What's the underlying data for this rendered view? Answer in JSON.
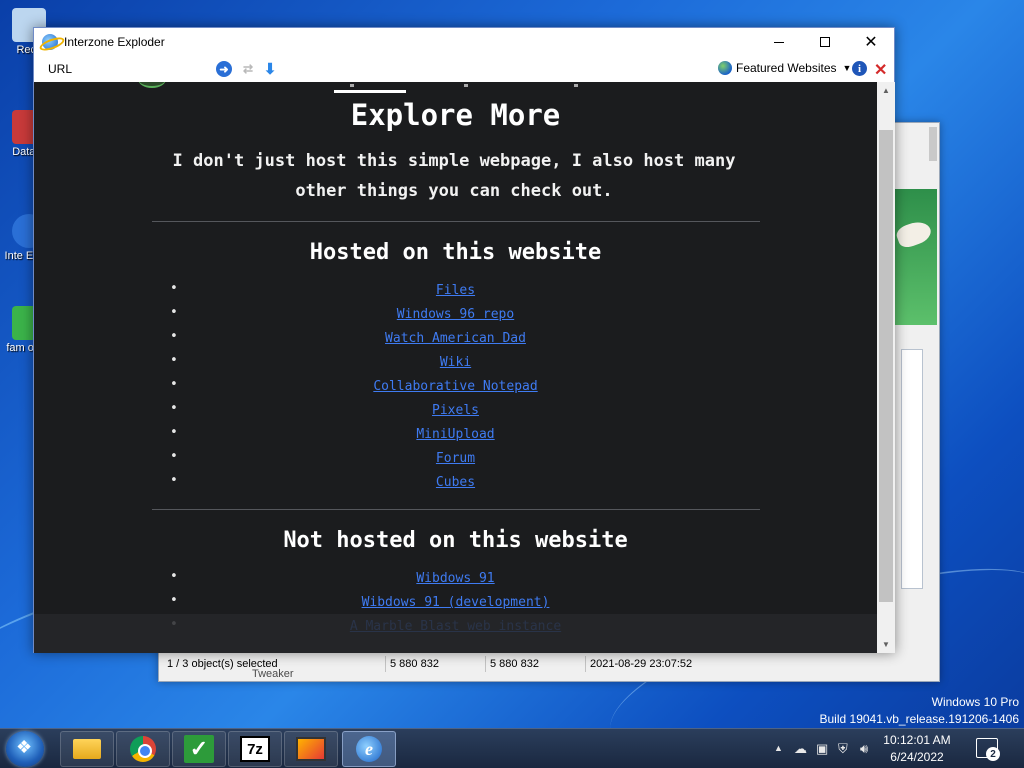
{
  "desktop": {
    "icons": [
      {
        "label": "Recy",
        "color": "#bcd6ef"
      },
      {
        "label": "DataW",
        "color": "#c83a3a"
      },
      {
        "label": "Inte Explo",
        "color": "#2a6fd6"
      },
      {
        "label": "fam optin",
        "color": "#3bb34a"
      }
    ],
    "watermark": {
      "edition": "Windows 10 Pro",
      "build": "Build 19041.vb_release.191206-1406"
    }
  },
  "background_window": {
    "status": [
      "1 / 3 object(s) selected",
      "5 880 832",
      "5 880 832",
      "2021-08-29 23:07:52"
    ],
    "under_label": "Tweaker"
  },
  "window": {
    "title": "Interzone Exploder",
    "toolbar": {
      "url_label": "URL",
      "featured_label": "Featured Websites"
    }
  },
  "page": {
    "heading": "Explore More",
    "intro": "I don't just host this simple webpage, I also host many other things you can check out.",
    "hosted": {
      "title": "Hosted on this website",
      "links": [
        "Files",
        "Windows 96 repo",
        "Watch American Dad",
        "Wiki",
        "Collaborative Notepad",
        "Pixels",
        "MiniUpload",
        "Forum",
        "Cubes"
      ]
    },
    "not_hosted": {
      "title": "Not hosted on this website",
      "links": [
        "Wibdows 91",
        "Wibdows 91 (development)",
        "A Marble Blast web instance"
      ]
    },
    "link_color": "#3f7bf2",
    "background_color": "#1b1c1e"
  },
  "taskbar": {
    "apps": [
      "file-explorer",
      "chrome",
      "checkmark-app",
      "7-zip",
      "media-app",
      "interzone-exploder"
    ],
    "clock": {
      "time": "10:12:01 AM",
      "date": "6/24/2022"
    },
    "notification_count": "2"
  }
}
